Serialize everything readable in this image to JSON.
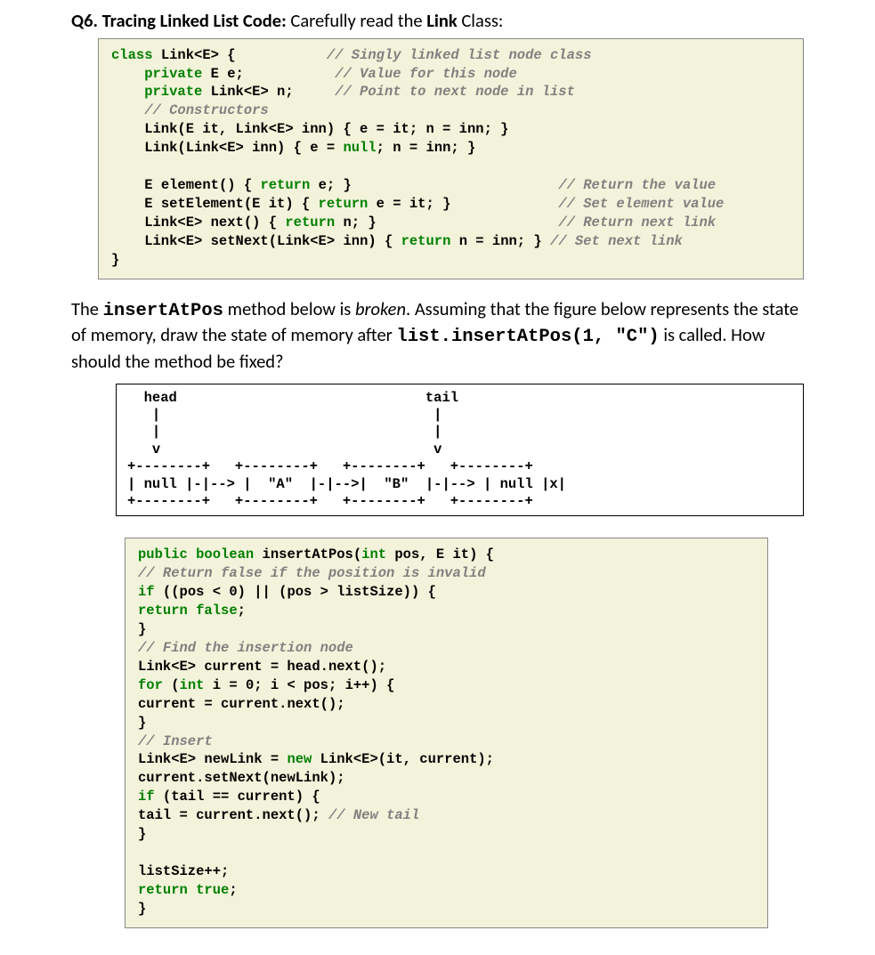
{
  "header": {
    "qnum": "Q6. Tracing Linked List Code:",
    "rest1": " Carefully read the ",
    "bold2": "Link",
    "rest2": " Class:"
  },
  "code1": {
    "l1a": "class",
    "l1b": " Link<E> {           ",
    "l1c": "// Singly linked list node class",
    "l2a": "    private",
    "l2b": " E e;           ",
    "l2c": "// Value for this node",
    "l3a": "    private",
    "l3b": " Link<E> n;     ",
    "l3c": "// Point to next node in list",
    "l4": "    // Constructors",
    "l5": "    Link(E it, Link<E> inn) { e = it; n = inn; }",
    "l6a": "    Link(Link<E> inn) { e = ",
    "l6b": "null",
    "l6c": "; n = inn; }",
    "blank": "",
    "l7a": "    E ",
    "l7b": "element",
    "l7c": "() { ",
    "l7d": "return",
    "l7e": " e; }                         ",
    "l7f": "// Return the value",
    "l8a": "    E ",
    "l8b": "setElement",
    "l8c": "(E it) { ",
    "l8d": "return",
    "l8e": " e = it; }             ",
    "l8f": "// Set element value",
    "l9a": "    Link<E> ",
    "l9b": "next",
    "l9c": "() { ",
    "l9d": "return",
    "l9e": " n; }                      ",
    "l9f": "// Return next link",
    "l10a": "    Link<E> ",
    "l10b": "setNext",
    "l10c": "(Link<E> inn) { ",
    "l10d": "return",
    "l10e": " n = inn; } ",
    "l10f": "// Set next link",
    "l11": "}"
  },
  "para": {
    "t1": "The ",
    "m1": "insertAtPos",
    "t2": " method below is ",
    "i1": "broken",
    "t3": ". Assuming that the figure below represents the state of memory, draw the state of memory after ",
    "m2": "list.insertAtPos(1, \"C\")",
    "t4": " is called. How should the method be fixed?"
  },
  "ascii": {
    "l1": "  head                              tail",
    "l2": "   |                                 |",
    "l3": "   |                                 |",
    "l4": "   v                                 v",
    "l5": "+--------+   +--------+   +--------+   +--------+",
    "l6": "| null |-|--> |  \"A\"  |-|-->|  \"B\"  |-|--> | null |x|",
    "l7": "+--------+   +--------+   +--------+   +--------+"
  },
  "code2": {
    "l1a": "public boolean",
    "l1b": " insertAtPos",
    "l1c": "(",
    "l1d": "int",
    "l1e": " pos, E it) {",
    "l2": "// Return false if the position is invalid",
    "l3a": "if",
    "l3b": " ((pos < ",
    "l3c": "0",
    "l3d": ") || (pos > listSize)) {",
    "l4a": "return false",
    "l4b": ";",
    "l5": "}",
    "l6": "// Find the insertion node",
    "l7a": "Link<E> current = head.",
    "l7b": "next",
    "l7c": "();",
    "l8a": "for",
    "l8b": " (",
    "l8c": "int",
    "l8d": " i = ",
    "l8e": "0",
    "l8f": "; i < pos; i++) {",
    "l9a": "current = current.",
    "l9b": "next",
    "l9c": "();",
    "l10": "}",
    "l11": "// Insert",
    "l12a": "Link<E> newLink = ",
    "l12b": "new",
    "l12c": " Link<E>(it, current);",
    "l13a": "current.",
    "l13b": "setNext",
    "l13c": "(newLink);",
    "l14a": "if",
    "l14b": " (tail == current) {",
    "l15a": "tail = current.",
    "l15b": "next",
    "l15c": "(); ",
    "l15d": "// New tail",
    "l16": "}",
    "blank": "",
    "l17": "listSize++;",
    "l18a": "return true",
    "l18b": ";",
    "l19": "}"
  }
}
